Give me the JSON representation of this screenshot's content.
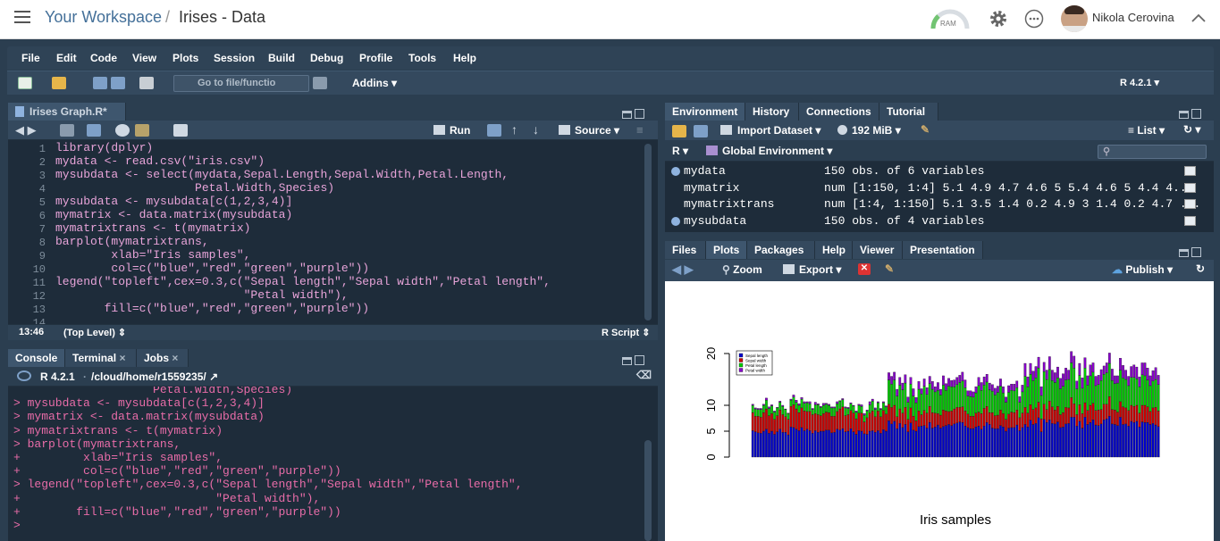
{
  "topbar": {
    "workspace": "Your Workspace",
    "separator": "/",
    "project": "Irises - Data",
    "ram_label": "RAM",
    "user_name": "Nikola Cerovina"
  },
  "menu": [
    "File",
    "Edit",
    "Code",
    "View",
    "Plots",
    "Session",
    "Build",
    "Debug",
    "Profile",
    "Tools",
    "Help"
  ],
  "toolbar": {
    "goto_placeholder": "Go to file/functio",
    "addins": "Addins",
    "r_version": "R 4.2.1"
  },
  "editor": {
    "tab": "Irises Graph.R*",
    "run": "Run",
    "source": "Source",
    "line_numbers": [
      "1",
      "2",
      "3",
      "4",
      "5",
      "6",
      "7",
      "8",
      "9",
      "10",
      "11",
      "12",
      "13",
      "14"
    ],
    "code_lines": [
      "library(dplyr)",
      "mydata <- read.csv(\"iris.csv\")",
      "mysubdata <- select(mydata,Sepal.Length,Sepal.Width,Petal.Length,",
      "                    Petal.Width,Species)",
      "mysubdata <- mysubdata[c(1,2,3,4)]",
      "mymatrix <- data.matrix(mysubdata)",
      "mymatrixtrans <- t(mymatrix)",
      "barplot(mymatrixtrans,",
      "        xlab=\"Iris samples\",",
      "        col=c(\"blue\",\"red\",\"green\",\"purple\"))",
      "legend(\"topleft\",cex=0.3,c(\"Sepal length\",\"Sepal width\",\"Petal length\",",
      "                           \"Petal width\"),",
      "       fill=c(\"blue\",\"red\",\"green\",\"purple\"))",
      ""
    ],
    "cursor_pos": "13:46",
    "scope": "(Top Level)",
    "file_type": "R Script"
  },
  "console": {
    "tabs": [
      "Console",
      "Terminal",
      "Jobs"
    ],
    "r_version": "R 4.2.1",
    "path": "/cloud/home/r1559235/",
    "lines": [
      "                    Petal.Width,Species)",
      "> mysubdata <- mysubdata[c(1,2,3,4)]",
      "> mymatrix <- data.matrix(mysubdata)",
      "> mymatrixtrans <- t(mymatrix)",
      "> barplot(mymatrixtrans,",
      "+         xlab=\"Iris samples\",",
      "+         col=c(\"blue\",\"red\",\"green\",\"purple\"))",
      "> legend(\"topleft\",cex=0.3,c(\"Sepal length\",\"Sepal width\",\"Petal length\",",
      "+                            \"Petal width\"),",
      "+        fill=c(\"blue\",\"red\",\"green\",\"purple\"))",
      "> "
    ]
  },
  "environment": {
    "tabs": [
      "Environment",
      "History",
      "Connections",
      "Tutorial"
    ],
    "import": "Import Dataset",
    "memory": "192 MiB",
    "list": "List",
    "lang": "R",
    "scope": "Global Environment",
    "rows": [
      {
        "name": "mydata",
        "value": "150 obs. of 6 variables",
        "expandable": true
      },
      {
        "name": "mymatrix",
        "value": "num [1:150, 1:4] 5.1 4.9 4.7 4.6 5 5.4 4.6 5 4.4 4...",
        "expandable": false
      },
      {
        "name": "mymatrixtrans",
        "value": "num [1:4, 1:150] 5.1 3.5 1.4 0.2 4.9 3 1.4 0.2 4.7 ...",
        "expandable": false
      },
      {
        "name": "mysubdata",
        "value": "150 obs. of 4 variables",
        "expandable": true
      }
    ]
  },
  "plots_pane": {
    "tabs": [
      "Files",
      "Plots",
      "Packages",
      "Help",
      "Viewer",
      "Presentation"
    ],
    "zoom": "Zoom",
    "export": "Export",
    "publish": "Publish"
  },
  "chart_data": {
    "type": "bar",
    "stacked": true,
    "xlabel": "Iris samples",
    "ylabel": "",
    "ylim": [
      0,
      20
    ],
    "yticks": [
      0,
      5,
      10,
      20
    ],
    "legend_position": "top-left",
    "series": [
      {
        "name": "Sepal length",
        "color": "#0000cc",
        "values": [
          5.1,
          4.9,
          4.7,
          4.6,
          5.0,
          5.4,
          4.6,
          5.0,
          4.4,
          4.9,
          5.4,
          4.8,
          4.8,
          4.3,
          5.8,
          5.7,
          5.4,
          5.1,
          5.7,
          5.1,
          5.4,
          5.1,
          4.6,
          5.1,
          4.8,
          5.0,
          5.0,
          5.2,
          5.2,
          4.7,
          4.8,
          5.4,
          5.2,
          5.5,
          4.9,
          5.0,
          5.5,
          4.9,
          4.4,
          5.1,
          5.0,
          4.5,
          4.4,
          5.0,
          5.1,
          4.8,
          5.1,
          4.6,
          5.3,
          5.0,
          7.0,
          6.4,
          6.9,
          5.5,
          6.5,
          5.7,
          6.3,
          4.9,
          6.6,
          5.2,
          5.0,
          5.9,
          6.0,
          6.1,
          5.6,
          6.7,
          5.6,
          5.8,
          6.2,
          5.6,
          5.9,
          6.1,
          6.3,
          6.1,
          6.4,
          6.6,
          6.8,
          6.7,
          6.0,
          5.7,
          5.5,
          5.5,
          5.8,
          6.0,
          5.4,
          6.0,
          6.7,
          6.3,
          5.6,
          5.5,
          5.5,
          6.1,
          5.8,
          5.0,
          5.6,
          5.7,
          5.7,
          6.2,
          5.1,
          5.7,
          6.3,
          5.8,
          7.1,
          6.3,
          6.5,
          7.6,
          4.9,
          7.3,
          6.7,
          7.2,
          6.5,
          6.4,
          6.8,
          5.7,
          5.8,
          6.4,
          6.5,
          7.7,
          7.7,
          6.0,
          6.9,
          5.6,
          7.7,
          6.3,
          6.7,
          7.2,
          6.2,
          6.1,
          6.4,
          7.2,
          7.4,
          7.9,
          6.4,
          6.3,
          6.1,
          7.7,
          6.3,
          6.4,
          6.0,
          6.9,
          6.7,
          6.9,
          5.8,
          6.8,
          6.7,
          6.7,
          6.3,
          6.5,
          6.2,
          5.9
        ]
      },
      {
        "name": "Sepal width",
        "color": "#cc0000",
        "values": [
          3.5,
          3.0,
          3.2,
          3.1,
          3.6,
          3.9,
          3.4,
          3.4,
          2.9,
          3.1,
          3.7,
          3.4,
          3.0,
          3.0,
          4.0,
          4.4,
          3.9,
          3.5,
          3.8,
          3.8,
          3.4,
          3.7,
          3.6,
          3.3,
          3.4,
          3.0,
          3.4,
          3.5,
          3.4,
          3.2,
          3.1,
          3.4,
          4.1,
          4.2,
          3.1,
          3.2,
          3.5,
          3.6,
          3.0,
          3.4,
          3.5,
          2.3,
          3.2,
          3.5,
          3.8,
          3.0,
          3.8,
          3.2,
          3.7,
          3.3,
          3.2,
          3.2,
          3.1,
          2.3,
          2.8,
          2.8,
          3.3,
          2.4,
          2.9,
          2.7,
          2.0,
          3.0,
          2.2,
          2.9,
          2.9,
          3.1,
          3.0,
          2.7,
          2.2,
          2.5,
          3.2,
          2.8,
          2.5,
          2.8,
          2.9,
          3.0,
          2.8,
          3.0,
          2.9,
          2.6,
          2.4,
          2.4,
          2.7,
          2.7,
          3.0,
          3.4,
          3.1,
          2.3,
          3.0,
          2.5,
          2.6,
          3.0,
          2.6,
          2.3,
          2.7,
          3.0,
          2.9,
          2.9,
          2.5,
          2.8,
          3.3,
          2.7,
          3.0,
          2.9,
          3.0,
          3.0,
          2.5,
          2.9,
          2.5,
          3.6,
          3.2,
          2.7,
          3.0,
          2.5,
          2.8,
          3.2,
          3.0,
          3.8,
          2.6,
          2.2,
          3.2,
          2.8,
          2.8,
          2.7,
          3.3,
          3.2,
          2.8,
          3.0,
          2.8,
          3.0,
          2.8,
          3.8,
          2.8,
          2.8,
          2.6,
          3.0,
          3.4,
          3.1,
          3.0,
          3.1,
          3.1,
          3.1,
          2.7,
          3.2,
          3.3,
          3.0,
          2.5,
          3.0,
          3.4,
          3.0
        ]
      },
      {
        "name": "Petal length",
        "color": "#00cc00",
        "values": [
          1.4,
          1.4,
          1.3,
          1.5,
          1.4,
          1.7,
          1.4,
          1.5,
          1.4,
          1.5,
          1.5,
          1.6,
          1.4,
          1.1,
          1.2,
          1.5,
          1.3,
          1.4,
          1.7,
          1.5,
          1.7,
          1.5,
          1.0,
          1.7,
          1.9,
          1.6,
          1.6,
          1.5,
          1.4,
          1.6,
          1.6,
          1.5,
          1.5,
          1.4,
          1.5,
          1.2,
          1.3,
          1.4,
          1.3,
          1.5,
          1.3,
          1.3,
          1.3,
          1.6,
          1.9,
          1.4,
          1.6,
          1.4,
          1.5,
          1.4,
          4.7,
          4.5,
          4.9,
          4.0,
          4.6,
          4.5,
          4.7,
          3.3,
          4.6,
          3.9,
          3.5,
          4.2,
          4.0,
          4.7,
          3.6,
          4.4,
          4.5,
          4.1,
          4.5,
          3.9,
          4.8,
          4.0,
          4.9,
          4.7,
          4.3,
          4.4,
          4.8,
          5.0,
          4.5,
          3.5,
          3.8,
          3.7,
          3.9,
          5.1,
          4.5,
          4.5,
          4.7,
          4.4,
          4.1,
          4.0,
          4.4,
          4.6,
          4.0,
          3.3,
          4.2,
          4.2,
          4.2,
          4.3,
          3.0,
          4.1,
          6.0,
          5.1,
          5.9,
          5.6,
          5.8,
          6.6,
          4.5,
          6.3,
          5.8,
          6.1,
          5.1,
          5.3,
          5.5,
          5.0,
          5.1,
          5.3,
          5.5,
          6.7,
          6.9,
          5.0,
          5.7,
          4.9,
          6.7,
          4.9,
          5.7,
          6.0,
          4.8,
          4.9,
          5.6,
          5.8,
          6.1,
          6.4,
          5.6,
          5.1,
          5.6,
          6.1,
          5.6,
          5.5,
          4.8,
          5.4,
          5.6,
          5.1,
          5.1,
          5.9,
          5.7,
          5.2,
          5.0,
          5.2,
          5.4,
          5.1
        ]
      },
      {
        "name": "Petal width",
        "color": "#8800cc",
        "values": [
          0.2,
          0.2,
          0.2,
          0.2,
          0.2,
          0.4,
          0.3,
          0.2,
          0.2,
          0.1,
          0.2,
          0.2,
          0.1,
          0.1,
          0.2,
          0.4,
          0.4,
          0.3,
          0.3,
          0.3,
          0.2,
          0.4,
          0.2,
          0.5,
          0.2,
          0.2,
          0.4,
          0.2,
          0.2,
          0.2,
          0.2,
          0.4,
          0.1,
          0.2,
          0.2,
          0.2,
          0.2,
          0.1,
          0.2,
          0.2,
          0.3,
          0.3,
          0.2,
          0.6,
          0.4,
          0.3,
          0.2,
          0.2,
          0.2,
          0.2,
          1.4,
          1.5,
          1.5,
          1.3,
          1.5,
          1.3,
          1.6,
          1.0,
          1.3,
          1.4,
          1.0,
          1.5,
          1.0,
          1.4,
          1.3,
          1.4,
          1.5,
          1.0,
          1.5,
          1.1,
          1.8,
          1.3,
          1.5,
          1.2,
          1.3,
          1.4,
          1.4,
          1.7,
          1.5,
          1.0,
          1.1,
          1.0,
          1.2,
          1.6,
          1.5,
          1.6,
          1.5,
          1.3,
          1.3,
          1.3,
          1.2,
          1.4,
          1.2,
          1.0,
          1.3,
          1.2,
          1.3,
          1.3,
          1.1,
          1.3,
          2.5,
          1.9,
          2.1,
          1.8,
          2.2,
          2.1,
          1.7,
          1.8,
          1.8,
          2.5,
          2.0,
          1.9,
          2.1,
          2.0,
          2.4,
          2.3,
          1.8,
          2.2,
          2.3,
          1.5,
          2.3,
          2.0,
          2.0,
          1.8,
          2.1,
          1.8,
          1.8,
          1.8,
          2.1,
          1.6,
          1.9,
          2.0,
          2.2,
          1.5,
          1.4,
          2.3,
          2.4,
          1.8,
          1.8,
          2.1,
          2.4,
          2.3,
          1.9,
          2.3,
          2.5,
          2.3,
          1.9,
          2.0,
          2.3,
          1.8
        ]
      }
    ]
  }
}
